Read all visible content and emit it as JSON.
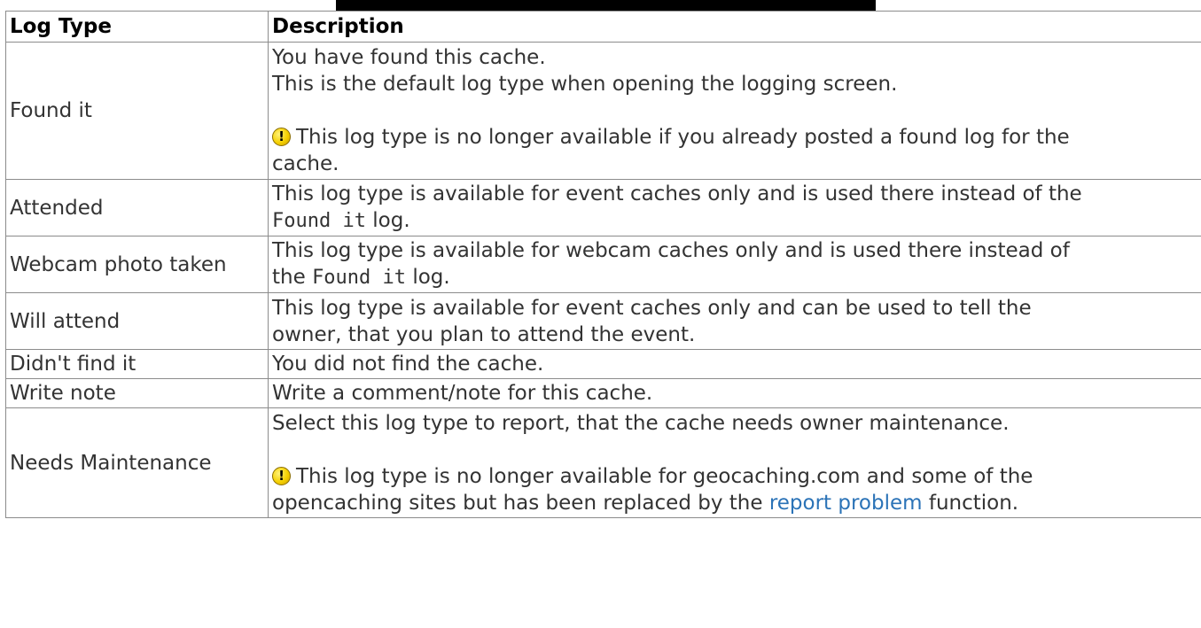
{
  "header": {
    "col_type": "Log Type",
    "col_desc": "Description"
  },
  "rows": {
    "found": {
      "type": "Found it",
      "line1": "You have found this cache.",
      "line2": "This is the default log type when opening the logging screen.",
      "warn_icon": "warning-icon",
      "warn1": "This log type is no longer available if you already posted a found log for the",
      "warn2": "cache."
    },
    "attended": {
      "type": "Attended",
      "line1": "This log type is available for event caches only and is used there instead of the",
      "code": "Found it",
      "after": " log."
    },
    "webcam": {
      "type": "Webcam photo taken",
      "line1": "This log type is available for webcam caches only and is used there instead of",
      "before": "the ",
      "code": "Found it",
      "after": " log."
    },
    "will_attend": {
      "type": "Will attend",
      "line1": "This log type is available for event caches only and can be used to tell the",
      "line2": "owner, that you plan to attend the event."
    },
    "didnt_find": {
      "type": "Didn't find it",
      "desc": "You did not find the cache."
    },
    "write_note": {
      "type": "Write note",
      "desc": "Write a comment/note for this cache."
    },
    "maintenance": {
      "type": "Needs Maintenance",
      "line1": "Select this log type to report, that the cache needs owner maintenance.",
      "warn_icon": "warning-icon",
      "warn1": "This log type is no longer available for geocaching.com and some of the",
      "warn2_before": "opencaching sites but has been replaced by the ",
      "link": "report problem",
      "warn2_after": " function."
    }
  },
  "colors": {
    "link": "#2b73b7",
    "border": "#8c8c8c",
    "text": "#333333"
  }
}
